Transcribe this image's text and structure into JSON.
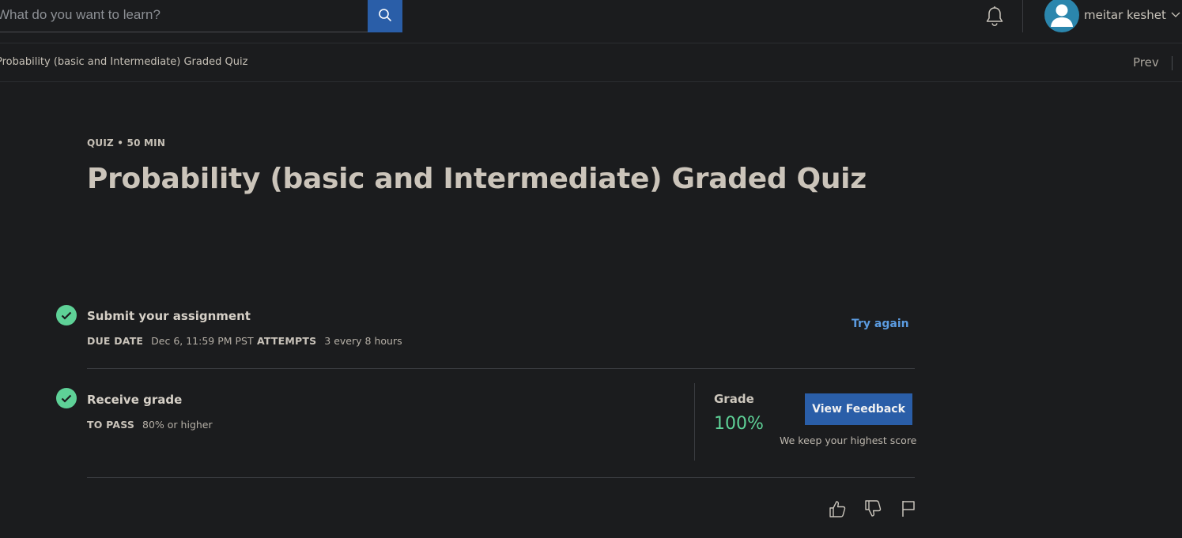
{
  "header": {
    "search": {
      "placeholder": "What do you want to learn?"
    },
    "user": {
      "name": "meitar keshet"
    }
  },
  "breadcrumb": {
    "current": "Probability (basic and Intermediate) Graded Quiz",
    "prev_label": "Prev"
  },
  "quiz": {
    "meta": "QUIZ • 50 MIN",
    "title": "Probability (basic and Intermediate) Graded Quiz"
  },
  "submit_section": {
    "title": "Submit your assignment",
    "due_label": "DUE DATE",
    "due_value": "Dec 6, 11:59 PM PST",
    "attempts_label": "ATTEMPTS",
    "attempts_value": "3 every 8 hours",
    "try_again_label": "Try again"
  },
  "grade_section": {
    "title": "Receive grade",
    "pass_label": "TO PASS",
    "pass_value": "80% or higher",
    "grade_label": "Grade",
    "grade_value": "100%",
    "view_feedback_label": "View Feedback",
    "keep_note": "We keep your highest score"
  },
  "icons": {
    "search": "search-icon",
    "bell": "bell-icon",
    "avatar": "user-avatar-icon",
    "chevron": "chevron-down-icon",
    "check": "check-circle-icon",
    "like": "thumbs-up-icon",
    "dislike": "thumbs-down-icon",
    "flag": "flag-icon"
  },
  "colors": {
    "background": "#1b1c1e",
    "primary_button": "#2a5ea8",
    "link": "#5b9be0",
    "success": "#5ed197",
    "avatar": "#2b86ad"
  }
}
